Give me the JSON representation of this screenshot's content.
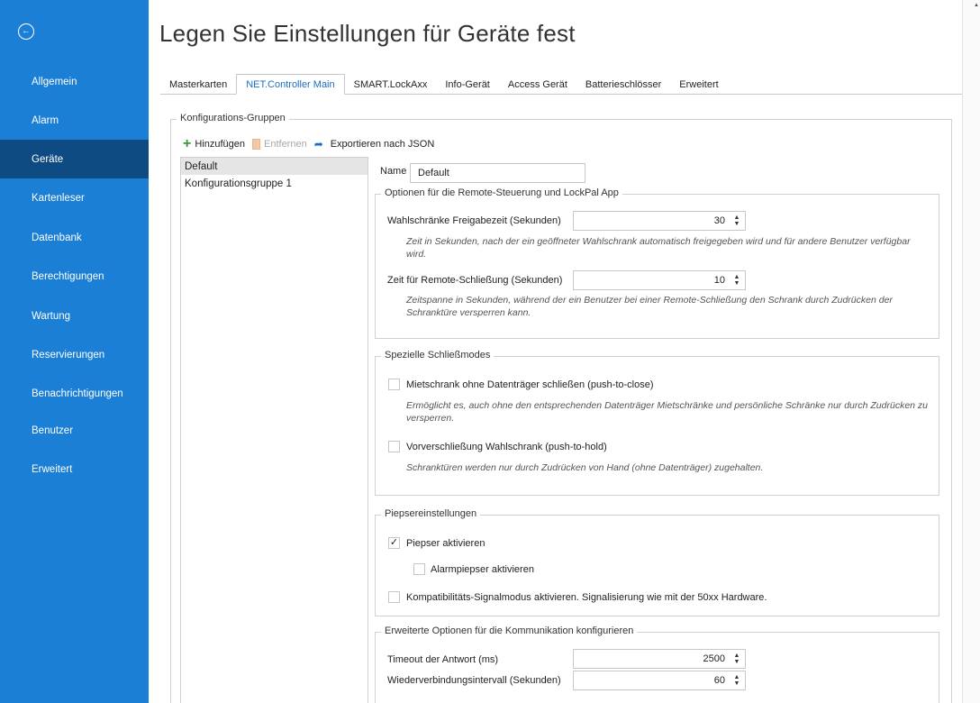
{
  "sidebar": {
    "back_icon": "back-arrow-circle-icon",
    "items": [
      {
        "label": "Allgemein"
      },
      {
        "label": "Alarm"
      },
      {
        "label": "Geräte",
        "active": true
      },
      {
        "label": "Kartenleser"
      },
      {
        "label": "Datenbank"
      },
      {
        "label": "Berechtigungen"
      },
      {
        "label": "Wartung"
      },
      {
        "label": "Reservierungen"
      },
      {
        "label": "Benachrichtigungen"
      },
      {
        "label": "Benutzer"
      },
      {
        "label": "Erweitert"
      }
    ]
  },
  "page": {
    "title": "Legen Sie Einstellungen für Geräte fest"
  },
  "tabs": [
    {
      "label": "Masterkarten"
    },
    {
      "label": "NET.Controller Main",
      "active": true
    },
    {
      "label": "SMART.LockAxx"
    },
    {
      "label": "Info-Gerät"
    },
    {
      "label": "Access Gerät"
    },
    {
      "label": "Batterieschlösser"
    },
    {
      "label": "Erweitert"
    }
  ],
  "groups": {
    "legend": "Konfigurations-Gruppen",
    "toolbar": {
      "add_label": "Hinzufügen",
      "remove_label": "Entfernen",
      "export_label": "Exportieren nach JSON"
    },
    "list": [
      {
        "label": "Default",
        "selected": true
      },
      {
        "label": "Konfigurationsgruppe 1"
      }
    ]
  },
  "details": {
    "name_label": "Name",
    "name_value": "Default",
    "remote": {
      "legend": "Optionen für die Remote-Steuerung und LockPal App",
      "release_label": "Wahlschränke Freigabezeit (Sekunden)",
      "release_value": "30",
      "release_hint": "Zeit in Sekunden, nach der ein geöffneter Wahlschrank automatisch freigegeben wird und für andere Benutzer verfügbar wird.",
      "lock_label": "Zeit für Remote-Schließung (Sekunden)",
      "lock_value": "10",
      "lock_hint": "Zeitspanne in Sekunden, während der ein Benutzer bei einer Remote-Schließung den Schrank durch Zudrücken der Schranktüre versperren kann."
    },
    "modes": {
      "legend": "Spezielle Schließmodes",
      "push_close_label": "Mietschrank ohne Datenträger schließen (push-to-close)",
      "push_close_checked": false,
      "push_close_hint": "Ermöglicht es, auch ohne den entsprechenden Datenträger Mietschränke und persönliche Schränke nur durch Zudrücken zu versperren.",
      "push_hold_label": "Vorverschließung Wahlschrank (push-to-hold)",
      "push_hold_checked": false,
      "push_hold_hint": "Schranktüren werden nur durch Zudrücken von Hand (ohne Datenträger) zugehalten."
    },
    "beeper": {
      "legend": "Piepsereinstellungen",
      "enable_label": "Piepser aktivieren",
      "enable_checked": true,
      "alarm_label": "Alarmpiepser aktivieren",
      "alarm_checked": false,
      "compat_label": "Kompatibilitäts-Signalmodus aktivieren. Signalisierung wie mit der 50xx Hardware.",
      "compat_checked": false
    },
    "comm": {
      "legend": "Erweiterte Optionen für die Kommunikation konfigurieren",
      "timeout_label": "Timeout der Antwort (ms)",
      "timeout_value": "2500",
      "reconnect_label": "Wiederverbindungsintervall (Sekunden)",
      "reconnect_value": "60"
    }
  }
}
